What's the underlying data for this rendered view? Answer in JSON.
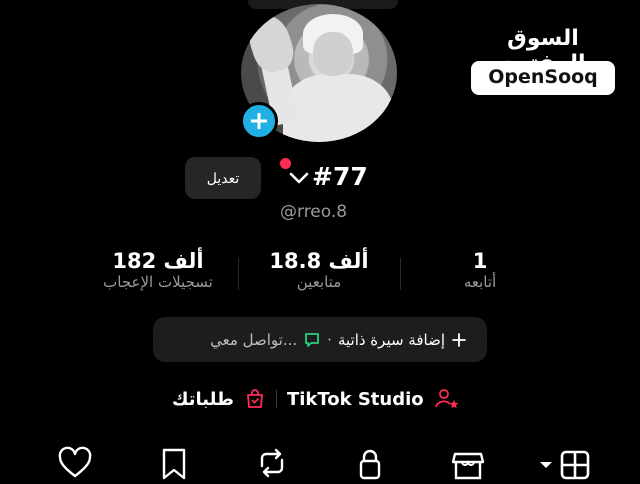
{
  "logo": {
    "arabic": "السوق المفتوح",
    "english": "OpenSooq"
  },
  "profile": {
    "edit_label": "تعديل",
    "name": "#77",
    "handle": "@rreo.8"
  },
  "stats": [
    {
      "value": "1",
      "label": "أتابعه"
    },
    {
      "value": "18.8 ألف",
      "label": "متابعين"
    },
    {
      "value": "182 ألف",
      "label": "تسجيلات الإعجاب"
    }
  ],
  "bio": {
    "add_label": "إضافة سيرة ذاتية",
    "dot": "·",
    "contact_label": "تواصل معي..."
  },
  "links": {
    "studio_label": "TikTok Studio",
    "orders_label": "طلباتك"
  },
  "colors": {
    "accent_blue": "#20b0e6",
    "accent_red": "#ff2d55",
    "accent_green": "#2bd07a",
    "bg": "#000000"
  },
  "nav_icons": [
    "heart-icon",
    "bookmark-icon",
    "repost-icon",
    "lock-icon",
    "shop-icon",
    "grid-icon"
  ]
}
